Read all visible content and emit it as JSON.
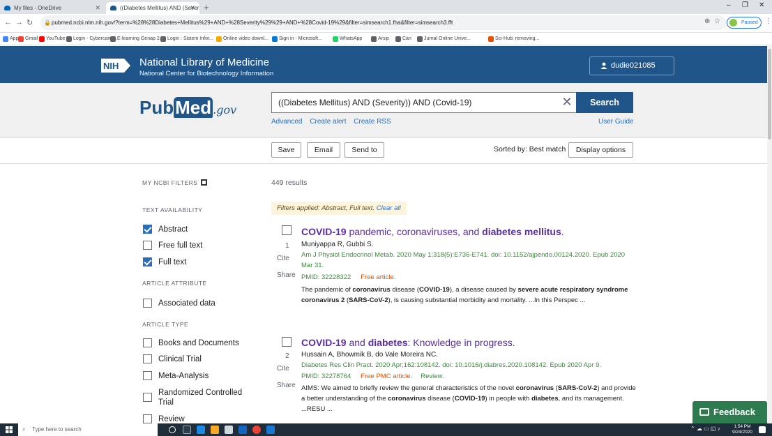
{
  "browser": {
    "tabs": [
      {
        "title": "My files - OneDrive",
        "favicon_color": "#0364b8"
      },
      {
        "title": "((Diabetes Mellitus) AND (Severi",
        "favicon_color": "#20558a"
      }
    ],
    "url": "pubmed.ncbi.nlm.nih.gov/?term=%28%28Diabetes+Mellitus%29+AND+%28Severity%29%29+AND+%28Covid-19%29&filter=simsearch1.fha&filter=simsearch3.fft",
    "profile_label": "Paused",
    "bookmarks": [
      {
        "label": "Apps",
        "color": "#4285f4"
      },
      {
        "label": "Gmail",
        "color": "#ea4335"
      },
      {
        "label": "YouTube",
        "color": "#ff0000"
      },
      {
        "label": "Login - Cybercamp...",
        "color": "#5f6368"
      },
      {
        "label": "E-learning Genap 2...",
        "color": "#5f6368"
      },
      {
        "label": "Login : Sistem Infor...",
        "color": "#5f6368"
      },
      {
        "label": "Online video downl...",
        "color": "#f9ab00"
      },
      {
        "label": "Sign in - Microsoft...",
        "color": "#0078d4"
      },
      {
        "label": "WhatsApp",
        "color": "#25d366"
      },
      {
        "label": "Arsip",
        "color": "#5f6368"
      },
      {
        "label": "Cari",
        "color": "#5f6368"
      },
      {
        "label": "Jurnal Online Unive...",
        "color": "#5f6368"
      },
      {
        "label": "Sci-Hub: removing...",
        "color": "#e65100"
      }
    ]
  },
  "nih": {
    "logo_text": "NIH",
    "title": "National Library of Medicine",
    "subtitle": "National Center for Biotechnology Information",
    "username": "dudie021085"
  },
  "search": {
    "logo_main": "Pub",
    "logo_med": "Med",
    "logo_gov": ".gov",
    "query": "((Diabetes Mellitus) AND (Severity)) AND (Covid-19)",
    "button_label": "Search",
    "links": [
      "Advanced",
      "Create alert",
      "Create RSS"
    ],
    "user_guide": "User Guide"
  },
  "actions": {
    "save": "Save",
    "email": "Email",
    "send_to": "Send to",
    "sorted_by": "Sorted by: Best match",
    "display_options": "Display options"
  },
  "sidebar": {
    "my_ncbi_filters": "MY NCBI FILTERS",
    "text_availability": "TEXT AVAILABILITY",
    "availability_filters": [
      {
        "label": "Abstract",
        "checked": true
      },
      {
        "label": "Free full text",
        "checked": false
      },
      {
        "label": "Full text",
        "checked": true
      }
    ],
    "article_attribute": "ARTICLE ATTRIBUTE",
    "attribute_filters": [
      {
        "label": "Associated data",
        "checked": false
      }
    ],
    "article_type": "ARTICLE TYPE",
    "type_filters": [
      {
        "label": "Books and Documents",
        "checked": false
      },
      {
        "label": "Clinical Trial",
        "checked": false
      },
      {
        "label": "Meta-Analysis",
        "checked": false
      },
      {
        "label": "Randomized Controlled Trial",
        "checked": false
      },
      {
        "label": "Review",
        "checked": false
      }
    ]
  },
  "results": {
    "count": "449 results",
    "filters_applied": "Filters applied: Abstract, Full text.",
    "clear_all": "Clear all",
    "cite": "Cite",
    "share": "Share",
    "items": [
      {
        "number": "1",
        "title_parts": [
          {
            "t": "COVID-19",
            "b": true
          },
          {
            "t": " pandemic, coronaviruses, and ",
            "b": false
          },
          {
            "t": "diabetes mellitus",
            "b": true
          },
          {
            "t": ".",
            "b": false
          }
        ],
        "authors": "Muniyappa R, Gubbi S.",
        "citation": "Am J Physiol Endocrinol Metab. 2020 May 1;318(5):E736-E741. doi: 10.1152/ajpendo.00124.2020. Epub 2020 Mar 31.",
        "pmid": "PMID: 32228322",
        "free": "Free article.",
        "review": "",
        "snippet_parts": [
          {
            "t": "The pandemic of ",
            "b": false
          },
          {
            "t": "coronavirus",
            "b": true
          },
          {
            "t": " disease (",
            "b": false
          },
          {
            "t": "COVID-19",
            "b": true
          },
          {
            "t": "), a disease caused by ",
            "b": false
          },
          {
            "t": "severe acute respiratory syndrome coronavirus 2",
            "b": true
          },
          {
            "t": " (",
            "b": false
          },
          {
            "t": "SARS-CoV-2",
            "b": true
          },
          {
            "t": "), is causing substantial morbidity and mortality. ...In this Perspec ...",
            "b": false
          }
        ]
      },
      {
        "number": "2",
        "title_parts": [
          {
            "t": "COVID-19",
            "b": true
          },
          {
            "t": " and ",
            "b": false
          },
          {
            "t": "diabetes",
            "b": true
          },
          {
            "t": ": Knowledge in progress.",
            "b": false
          }
        ],
        "authors": "Hussain A, Bhowmik B, do Vale Moreira NC.",
        "citation": "Diabetes Res Clin Pract. 2020 Apr;162:108142. doi: 10.1016/j.diabres.2020.108142. Epub 2020 Apr 9.",
        "pmid": "PMID: 32278764",
        "free": "Free PMC article.",
        "review": "Review.",
        "snippet_parts": [
          {
            "t": "AIMS: We aimed to briefly review the general characteristics of the novel ",
            "b": false
          },
          {
            "t": "coronavirus",
            "b": true
          },
          {
            "t": " (",
            "b": false
          },
          {
            "t": "SARS-CoV-2",
            "b": true
          },
          {
            "t": ") and provide a better understanding of the ",
            "b": false
          },
          {
            "t": "coronavirus",
            "b": true
          },
          {
            "t": " disease (",
            "b": false
          },
          {
            "t": "COVID-19",
            "b": true
          },
          {
            "t": ") in people with ",
            "b": false
          },
          {
            "t": "diabetes",
            "b": true
          },
          {
            "t": ", and its management. ...RESU ...",
            "b": false
          }
        ]
      }
    ]
  },
  "feedback_label": "Feedback",
  "taskbar": {
    "search_placeholder": "Type here to search",
    "time": "1:54 PM",
    "date": "9/24/2020"
  },
  "colors": {
    "nih_blue": "#20558a",
    "link_blue": "#2a6ebb",
    "title_purple": "#5b2ea6",
    "citation_green": "#3b8a3b",
    "free_orange": "#e65100",
    "feedback_green": "#2d7b4f"
  }
}
